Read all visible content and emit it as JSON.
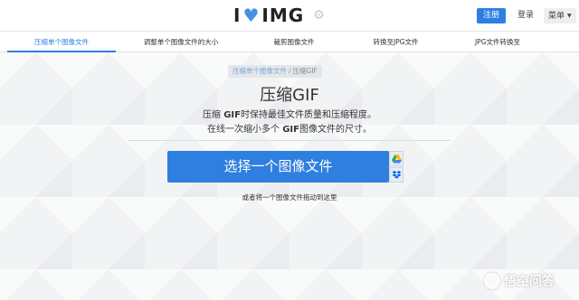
{
  "header": {
    "logo_left": "I",
    "logo_right": "IMG",
    "register_label": "注册",
    "login_label": "登录",
    "menu_label": "菜单"
  },
  "tools": [
    {
      "label": "压缩单个图像文件",
      "active": true
    },
    {
      "label": "调整单个图像文件的大小"
    },
    {
      "label": "裁剪图像文件"
    },
    {
      "label": "转换至JPG文件"
    },
    {
      "label": "JPG文件转换至"
    }
  ],
  "breadcrumb": {
    "parent": "压缩单个图像文件",
    "separator": "/",
    "current": "压缩GIF"
  },
  "main": {
    "title": "压缩GIF",
    "desc1_a": "压缩 ",
    "desc1_bold": "GIF",
    "desc1_b": "时保持最佳文件质量和压缩程度。",
    "desc2_a": "在线一次缩小多个 ",
    "desc2_bold": "GIF",
    "desc2_b": "图像文件的尺寸。",
    "select_button": "选择一个图像文件",
    "drop_hint": "或者将一个图像文件拖动到这里"
  },
  "watermark": {
    "text": "悟空问答"
  },
  "colors": {
    "accent": "#2f7fe0",
    "heart": "#4a90e2"
  },
  "icons": {
    "logo_heart": "heart-icon",
    "google_drive": "google-drive-icon",
    "dropbox": "dropbox-icon"
  }
}
